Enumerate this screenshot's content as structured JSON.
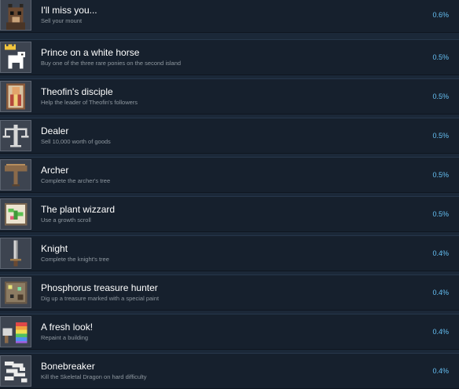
{
  "achievements": [
    {
      "name": "I'll miss you...",
      "description": "Sell your mount",
      "percent": "0.6%",
      "icon": "horse-head-icon"
    },
    {
      "name": "Prince on a white horse",
      "description": "Buy one of the three rare ponies on the second island",
      "percent": "0.5%",
      "icon": "white-horse-crown-icon"
    },
    {
      "name": "Theofin's disciple",
      "description": "Help the leader of Theofin's followers",
      "percent": "0.5%",
      "icon": "portrait-icon"
    },
    {
      "name": "Dealer",
      "description": "Sell 10,000 worth of goods",
      "percent": "0.5%",
      "icon": "scales-icon"
    },
    {
      "name": "Archer",
      "description": "Complete the archer's tree",
      "percent": "0.5%",
      "icon": "crossbow-icon"
    },
    {
      "name": "The plant wizzard",
      "description": "Use a growth scroll",
      "percent": "0.5%",
      "icon": "plant-scroll-icon"
    },
    {
      "name": "Knight",
      "description": "Complete the knight's tree",
      "percent": "0.4%",
      "icon": "sword-icon"
    },
    {
      "name": "Phosphorus treasure hunter",
      "description": "Dig up a treasure marked with a special paint",
      "percent": "0.4%",
      "icon": "treasure-map-icon"
    },
    {
      "name": "A fresh look!",
      "description": "Repaint a building",
      "percent": "0.4%",
      "icon": "paint-roller-icon"
    },
    {
      "name": "Bonebreaker",
      "description": "Kill the Skeletal Dragon on hard difficulty",
      "percent": "0.4%",
      "icon": "dragon-bone-icon"
    }
  ]
}
